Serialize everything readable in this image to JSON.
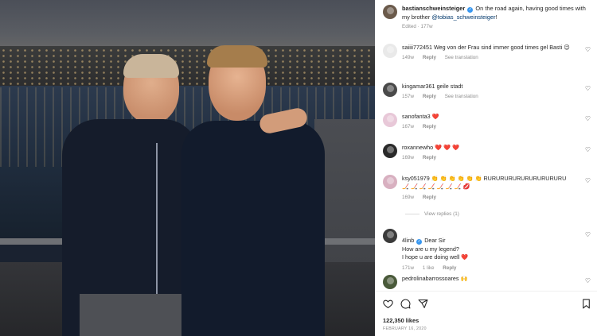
{
  "post": {
    "author": "bastianschweinsteiger",
    "caption": "On the road again, having good times with my brother",
    "mention": "@tobias_schweinsteiger",
    "caption_end": "!",
    "edited": "Edited",
    "age": "177w"
  },
  "comments": [
    {
      "user": "saiiii772451",
      "text": "Weg von der Frau sind immer good times gel Basti 😉",
      "age": "149w",
      "reply": "Reply",
      "extra": "See translation",
      "verified": false
    },
    {
      "user": "kingamar361",
      "text": "geile stadt",
      "age": "157w",
      "reply": "Reply",
      "extra": "See translation",
      "verified": false
    },
    {
      "user": "sanofanta3",
      "text": "❤️",
      "age": "167w",
      "reply": "Reply",
      "extra": "",
      "verified": false
    },
    {
      "user": "roxannewho",
      "text": "❤️ ❤️ ❤️",
      "age": "169w",
      "reply": "Reply",
      "extra": "",
      "verified": false
    },
    {
      "user": "ksy051979",
      "text": "👏 👏 👏 👏 👏 👏 RURURURURURURURURURU 🏒 🏒 🏒 🏒 🏒 🏒 🏒 💋",
      "age": "169w",
      "reply": "Reply",
      "extra": "",
      "verified": false
    },
    {
      "user": "4linb",
      "text": "Dear Sir\nHow are u my legend?\nI hope u are doing well ❤️",
      "age": "171w",
      "likes": "1 like",
      "reply": "Reply",
      "extra": "",
      "verified": true
    },
    {
      "user": "pedrolinabarrossoares",
      "text": "🙌",
      "age": "",
      "reply": "",
      "extra": "",
      "verified": false
    }
  ],
  "view_replies": "View replies (1)",
  "actions": {
    "likes": "122,350 likes",
    "date": "FEBRUARY 16, 2020"
  },
  "icons": {
    "like": "heart-icon",
    "comment": "comment-icon",
    "share": "send-icon",
    "save": "bookmark-icon"
  }
}
